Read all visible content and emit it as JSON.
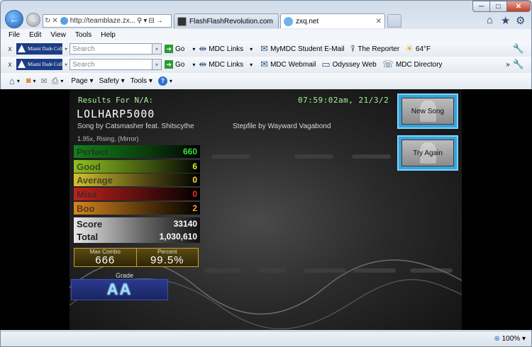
{
  "browser": {
    "address": "http://teamblaze.zx...",
    "tabs": [
      {
        "label": "FlashFlashRevolution.com"
      },
      {
        "label": "zxq.net"
      }
    ],
    "window_buttons": {
      "minimize": "─",
      "maximize": "□",
      "close": "✕"
    },
    "menu": [
      "File",
      "Edit",
      "View",
      "Tools",
      "Help"
    ],
    "toolbar1": {
      "search_placeholder": "Search",
      "go": "Go",
      "links": [
        "MDC Links",
        "MyMDC Student E-Mail",
        "The Reporter",
        "64°F"
      ]
    },
    "toolbar2": {
      "search_placeholder": "Search",
      "go": "Go",
      "links": [
        "MDC Links",
        "MDC Webmail",
        "Odyssey Web",
        "MDC Directory"
      ]
    },
    "command_bar": {
      "page": "Page",
      "safety": "Safety",
      "tools": "Tools"
    },
    "logo_text": "Miami Dade College",
    "zoom": "100%"
  },
  "game": {
    "results_for": "Results For N/A:",
    "timestamp": "07:59:02am, 21/3/2",
    "player": "LOLHARP5000",
    "song_by": "Song by Catsmasher feat. Shitscythe",
    "stepfile_by": "Stepfile by Wayward Vagabond",
    "modifiers": "1.95x, Rising, (Mirror)",
    "judgements": [
      {
        "label": "Perfect",
        "value": "660",
        "color": "#35e035"
      },
      {
        "label": "Good",
        "value": "6",
        "color": "#c8f03c"
      },
      {
        "label": "Average",
        "value": "0",
        "color": "#ffe040"
      },
      {
        "label": "Miss",
        "value": "0",
        "color": "#ff2a2a"
      },
      {
        "label": "Boo",
        "value": "2",
        "color": "#ffa030"
      }
    ],
    "score_label": "Score",
    "score": "33140",
    "total_label": "Total",
    "total": "1,030,610",
    "max_combo_label": "Max Combo",
    "max_combo": "666",
    "percent_label": "Percent",
    "percent": "99.5%",
    "grade_label": "Grade",
    "grade": "AA",
    "new_song": "New Song",
    "try_again": "Try Again"
  }
}
